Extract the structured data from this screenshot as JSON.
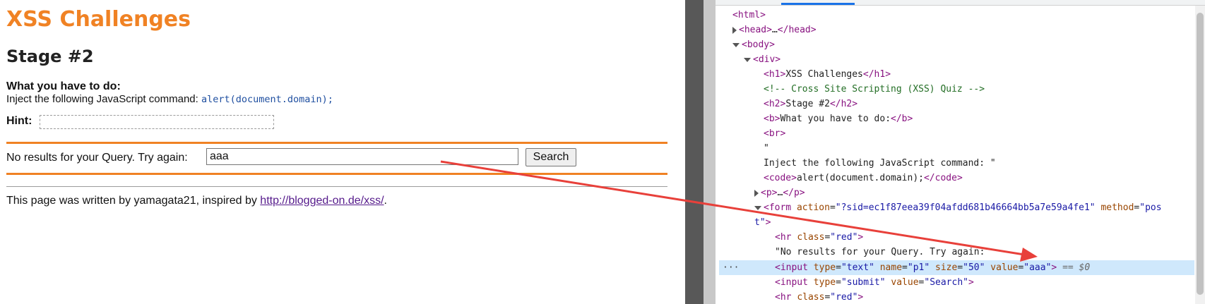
{
  "page": {
    "title": "XSS Challenges",
    "stage": "Stage #2",
    "todo_title": "What you have to do:",
    "todo_text": "Inject the following JavaScript command: ",
    "todo_code": "alert(document.domain);",
    "hint_label": "Hint:",
    "query_label": "No results for your Query. Try again:",
    "query_value": "aaa",
    "search_label": "Search",
    "footer_text": "This page was written by yamagata21, inspired by ",
    "footer_link": "http://blogged-on.de/xss/",
    "footer_end": ".",
    "accent_color": "#f08224"
  },
  "devtools": {
    "lines": [
      {
        "html": "&lt;html&gt;"
      },
      {
        "html": "&lt;head&gt;…&lt;/head&gt;"
      },
      {
        "html": "&lt;body&gt;"
      },
      {
        "html": "&lt;div&gt;"
      },
      {
        "t": "h1",
        "txt": "XSS Challenges"
      },
      {
        "c": "<!-- Cross Site Scripting (XSS) Quiz -->"
      },
      {
        "t": "h2",
        "txt": "Stage #2"
      },
      {
        "t": "b",
        "txt": "What you have to do:"
      },
      {
        "t": "br"
      },
      {
        "q": "\""
      },
      {
        "q": "Inject the following JavaScript command: \""
      },
      {
        "t": "code",
        "txt": "alert(document.domain);"
      },
      {
        "t": "p",
        "txt": "…"
      },
      {
        "form_action": "?sid=ec1f87eea39f04afdd681b46664bb5a7e59a4fe1",
        "form_method": "pos",
        "form_method_wrap": "t"
      },
      {
        "hr_class": "red"
      },
      {
        "q": "\"No results for your Query. Try again:"
      },
      {
        "input_type": "text",
        "input_name": "p1",
        "input_size": "50",
        "input_value": "aaa",
        "marker": "== $0"
      },
      {
        "input_type": "submit",
        "input_value": "Search"
      },
      {
        "hr_class": "red"
      }
    ],
    "selected_marker": "···"
  }
}
